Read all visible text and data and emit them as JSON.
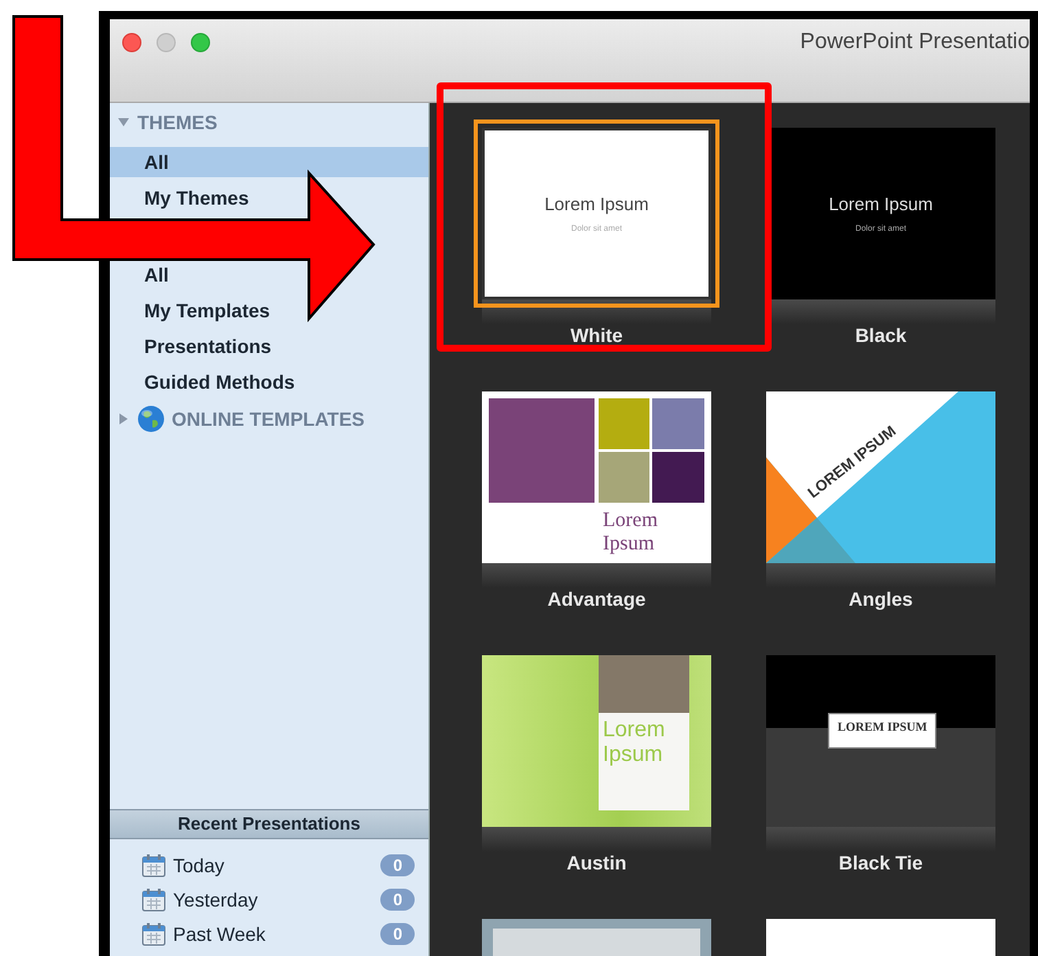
{
  "window": {
    "title": "PowerPoint Presentatio"
  },
  "sidebar": {
    "groups": [
      {
        "title": "THEMES",
        "expanded": true,
        "kind": "section",
        "items": [
          {
            "label": "All",
            "selected": true
          },
          {
            "label": "My Themes",
            "selected": false
          }
        ]
      },
      {
        "kind": "section",
        "items": [
          {
            "label": "All",
            "selected": false
          },
          {
            "label": "My Templates",
            "selected": false
          },
          {
            "label": "Presentations",
            "selected": false
          },
          {
            "label": "Guided Methods",
            "selected": false
          }
        ]
      },
      {
        "title": "ONLINE TEMPLATES",
        "expanded": false,
        "kind": "online"
      }
    ]
  },
  "recent": {
    "title": "Recent Presentations",
    "items": [
      {
        "label": "Today",
        "count": "0"
      },
      {
        "label": "Yesterday",
        "count": "0"
      },
      {
        "label": "Past Week",
        "count": "0"
      }
    ]
  },
  "gallery": [
    {
      "name": "White",
      "selected": true,
      "kind": "white",
      "slide": {
        "title": "Lorem Ipsum",
        "subtitle": "Dolor sit amet"
      }
    },
    {
      "name": "Black",
      "selected": false,
      "kind": "black",
      "slide": {
        "title": "Lorem Ipsum",
        "subtitle": "Dolor sit amet"
      }
    },
    {
      "name": "Advantage",
      "selected": false,
      "kind": "advantage",
      "slide": {
        "title": "Lorem Ipsum"
      }
    },
    {
      "name": "Angles",
      "selected": false,
      "kind": "angles",
      "slide": {
        "title": "LOREM IPSUM"
      }
    },
    {
      "name": "Austin",
      "selected": false,
      "kind": "austin",
      "slide": {
        "title": "Lorem Ipsum"
      }
    },
    {
      "name": "Black Tie",
      "selected": false,
      "kind": "blacktie",
      "slide": {
        "title": "LOREM IPSUM"
      }
    },
    {
      "selected": false,
      "kind": "bluegray"
    },
    {
      "selected": false,
      "kind": "plainwhite"
    }
  ]
}
